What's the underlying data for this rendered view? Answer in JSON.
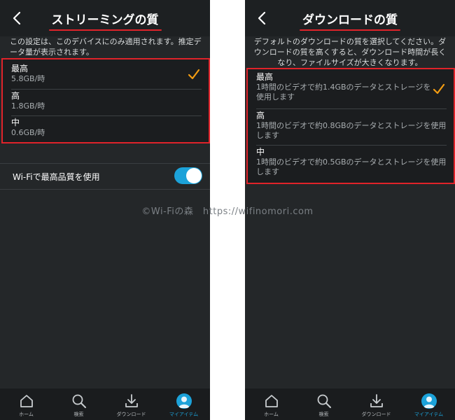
{
  "streaming": {
    "title": "ストリーミングの質",
    "description": "この設定は、このデバイスにのみ適用されます。推定データ量が表示されます。",
    "options": [
      {
        "name": "最高",
        "detail": "5.8GB/時",
        "selected": true
      },
      {
        "name": "高",
        "detail": "1.8GB/時",
        "selected": false
      },
      {
        "name": "中",
        "detail": "0.6GB/時",
        "selected": false
      }
    ],
    "wifi_label": "Wi-Fiで最高品質を使用",
    "wifi_enabled": true
  },
  "download": {
    "title": "ダウンロードの質",
    "description": "デフォルトのダウンロードの質を選択してください。ダウンロードの質を高くすると、ダウンロード時間が長くなり、ファイルサイズが大きくなります。",
    "options": [
      {
        "name": "最高",
        "detail": "1時間のビデオで約1.4GBのデータとストレージを使用します",
        "selected": true
      },
      {
        "name": "高",
        "detail": "1時間のビデオで約0.8GBのデータとストレージを使用します",
        "selected": false
      },
      {
        "name": "中",
        "detail": "1時間のビデオで約0.5GBのデータとストレージを使用します",
        "selected": false
      }
    ]
  },
  "nav": {
    "items": [
      {
        "label": "ホーム",
        "icon": "home-icon"
      },
      {
        "label": "検索",
        "icon": "search-icon"
      },
      {
        "label": "ダウンロード",
        "icon": "download-icon"
      },
      {
        "label": "マイアイテム",
        "icon": "avatar",
        "active": true
      }
    ]
  },
  "watermark": "©Wi-Fiの森　https://wifinomori.com",
  "colors": {
    "accent": "#1ca2d9",
    "check": "#f39c12",
    "highlight_border": "#e0232a",
    "background": "#242729"
  }
}
